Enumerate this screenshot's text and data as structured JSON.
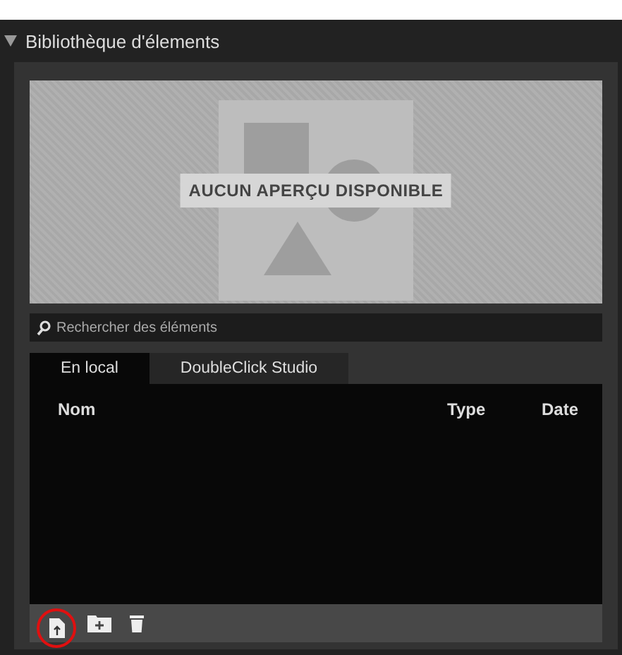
{
  "panel": {
    "title": "Bibliothèque d'élements",
    "expanded": true
  },
  "preview": {
    "message": "AUCUN APERÇU DISPONIBLE"
  },
  "search": {
    "placeholder": "Rechercher des éléments"
  },
  "tabs": [
    {
      "label": "En local",
      "selected": true
    },
    {
      "label": "DoubleClick Studio",
      "selected": false
    }
  ],
  "table": {
    "columns": [
      "Nom",
      "Type",
      "Date"
    ]
  },
  "toolbar": [
    {
      "kind": "import",
      "highlighted": true
    },
    {
      "kind": "new-folder",
      "highlighted": false
    },
    {
      "kind": "delete",
      "highlighted": false
    }
  ]
}
